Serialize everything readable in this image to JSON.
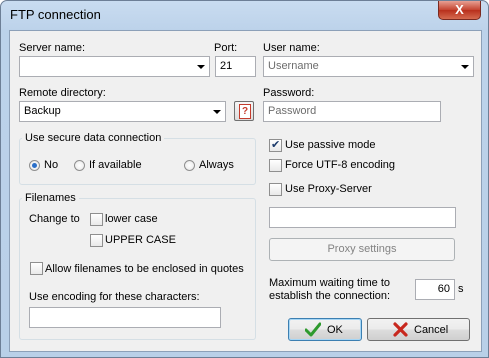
{
  "window": {
    "title": "FTP connection",
    "close_label": "X"
  },
  "server": {
    "label": "Server name:",
    "value": ""
  },
  "port": {
    "label": "Port:",
    "value": "21"
  },
  "user": {
    "label": "User name:",
    "placeholder": "Username"
  },
  "remote": {
    "label": "Remote directory:",
    "value": "Backup",
    "help_label": "?"
  },
  "password": {
    "label": "Password:",
    "placeholder": "Password"
  },
  "secure": {
    "title": "Use secure data connection",
    "options": [
      {
        "label": "No",
        "selected": true
      },
      {
        "label": "If available",
        "selected": false
      },
      {
        "label": "Always",
        "selected": false
      }
    ]
  },
  "filenames": {
    "title": "Filenames",
    "change_to_label": "Change to",
    "lower_case": {
      "label": "lower case",
      "checked": false
    },
    "upper_case": {
      "label": "UPPER CASE",
      "checked": false
    },
    "allow_quotes": {
      "label": "Allow filenames to be enclosed in quotes",
      "checked": false
    },
    "encoding_label": "Use encoding for these characters:",
    "encoding_value": ""
  },
  "options": {
    "passive": {
      "label": "Use passive mode",
      "checked": true
    },
    "utf8": {
      "label": "Force UTF-8 encoding",
      "checked": false
    },
    "proxy": {
      "label": "Use Proxy-Server",
      "checked": false
    },
    "proxy_value": "",
    "proxy_settings_label": "Proxy settings"
  },
  "timeout": {
    "label_line1": "Maximum waiting time to",
    "label_line2": "establish the connection:",
    "value": "60",
    "unit": "s"
  },
  "buttons": {
    "ok": "OK",
    "cancel": "Cancel"
  },
  "colors": {
    "ok_icon": "#2e9a2e",
    "cancel_icon": "#c8281e",
    "close_button": "#c4432f"
  }
}
